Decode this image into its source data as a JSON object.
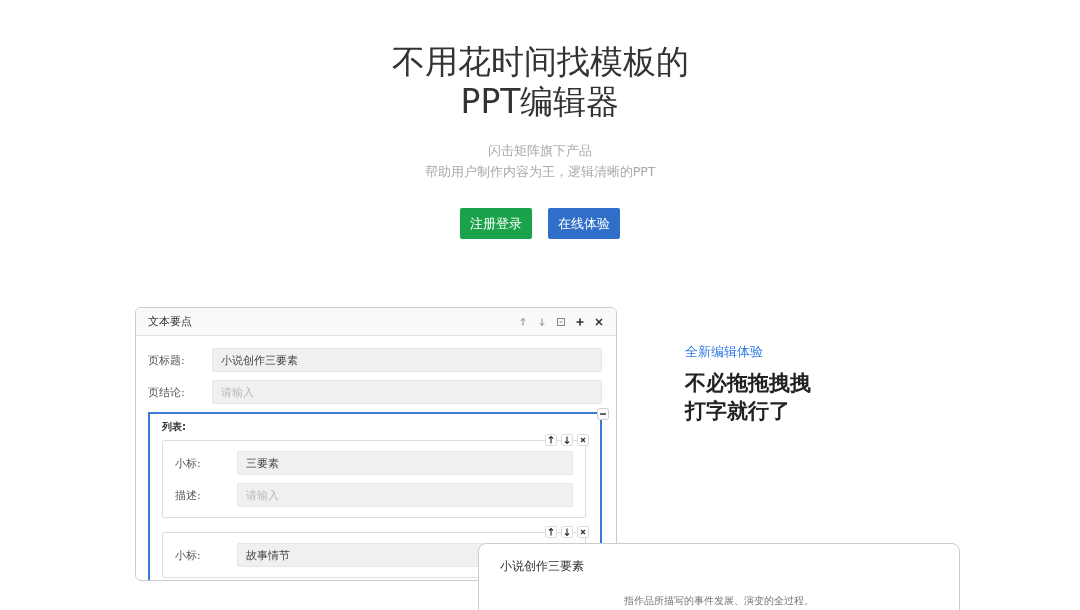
{
  "hero": {
    "title_lines": [
      "不用花时间找模板的",
      "PPT编辑器"
    ],
    "subtitle_lines": [
      "闪击矩阵旗下产品",
      "帮助用户制作内容为王，逻辑清晰的PPT"
    ],
    "buttons": [
      {
        "label": "注册登录",
        "kind": "primary"
      },
      {
        "label": "在线体验",
        "kind": "secondary"
      }
    ]
  },
  "editor": {
    "title": "文本要点",
    "fields": [
      {
        "label": "页标题:",
        "value": "小说创作三要素"
      },
      {
        "label": "页结论:",
        "placeholder": "请输入"
      }
    ],
    "list": {
      "label": "列表:",
      "items": [
        {
          "fields": [
            {
              "label": "小标:",
              "value": "三要素"
            },
            {
              "label": "描述:",
              "placeholder": "请输入"
            }
          ]
        },
        {
          "fields": [
            {
              "label": "小标:",
              "value": "故事情节"
            }
          ]
        }
      ]
    }
  },
  "feature": {
    "eyebrow": "全新编辑体验",
    "headline_lines": [
      "不必拖拖拽拽",
      "打字就行了"
    ]
  },
  "preview": {
    "title": "小说创作三要素",
    "body": "指作品所描写的事件发展、演变的全过程。"
  }
}
